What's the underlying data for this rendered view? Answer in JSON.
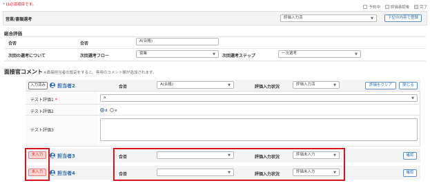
{
  "required_note": "* は必須項目です。",
  "legend": {
    "items": [
      {
        "label": "予約中"
      },
      {
        "label": "評価承認後"
      },
      {
        "label": "完了"
      }
    ]
  },
  "header": {
    "title": "営業/書類選考",
    "status_select": "評価入力済",
    "register_button": "下記の内容で登録"
  },
  "overall": {
    "title": "総合評価",
    "result_label": "合否",
    "result_field_label": "合否",
    "result_value": "A(合格)",
    "next_label": "次回の選考について",
    "next_flow_label": "次回選考フロー",
    "next_flow_value": "営業",
    "next_step_label": "次回選考ステップ",
    "next_step_value": "一次選考"
  },
  "comments": {
    "title": "面接官コメント",
    "note": "※面接担当者の設定をすると、専用のコメント欄が追加されます。",
    "interviewers": [
      {
        "status": "入力済み",
        "name": "担当者2",
        "result_label": "合否",
        "result_value": "A(合格)",
        "eval_status_label": "評価入力状況",
        "eval_status_value": "評価入力済",
        "clear_button": "評価をクリア",
        "close_button": "閉じる",
        "fields": {
          "test1_label": "テスト評価1",
          "test1_required": "*",
          "test1_value": "a",
          "test2_label": "テスト評価2",
          "test2_opt1": "d",
          "test2_opt2": "e",
          "test3_label": "テスト評価3"
        }
      },
      {
        "status": "未入力",
        "name": "担当者3",
        "result_label": "合否",
        "result_value": "",
        "eval_status_label": "評価入力状況",
        "eval_status_value": "評価未入力",
        "confirm_button": "確認"
      },
      {
        "status": "未入力",
        "name": "担当者4",
        "result_label": "合否",
        "result_value": "",
        "eval_status_label": "評価入力状況",
        "eval_status_value": "評価未入力",
        "confirm_button": "確認"
      }
    ]
  },
  "colors": {
    "accent": "#2b6cb0",
    "required": "#d7141a",
    "todo_badge": "#fbd2d2",
    "highlight_border": "#d7141a"
  }
}
